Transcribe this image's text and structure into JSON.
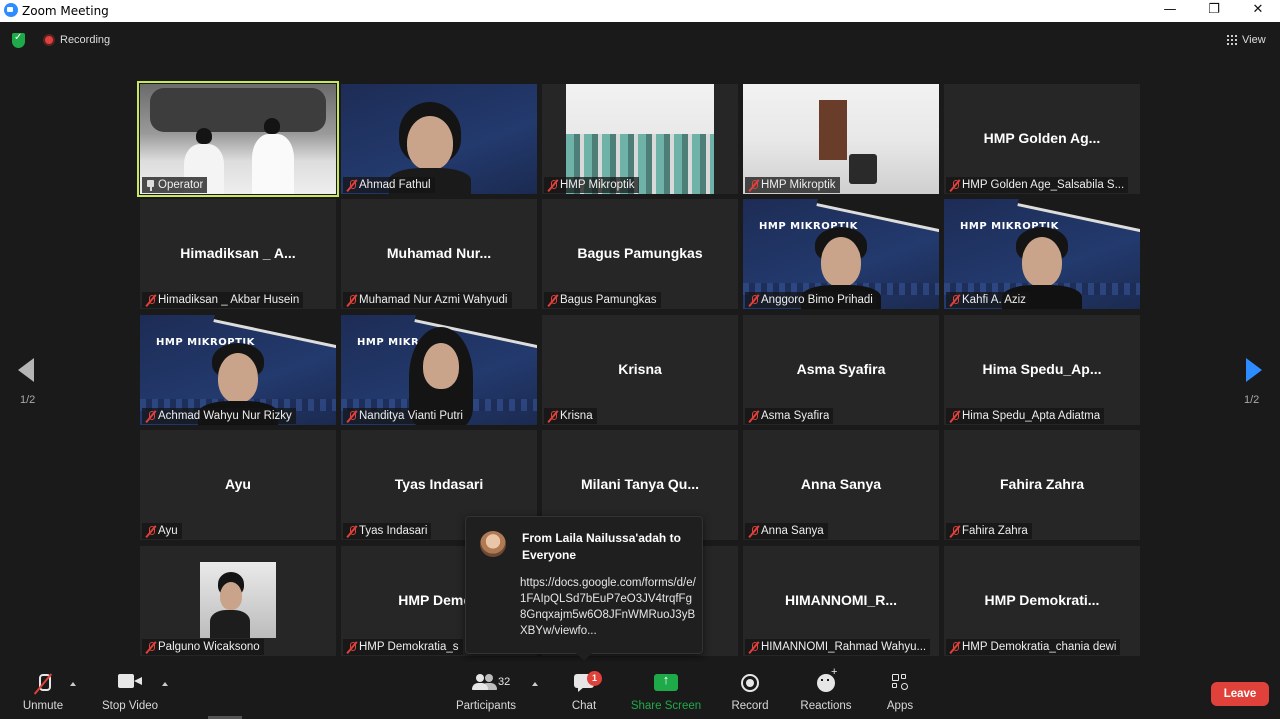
{
  "window": {
    "title": "Zoom Meeting",
    "minimize_glyph": "—",
    "restore_glyph": "❐",
    "close_glyph": "✕"
  },
  "topbar": {
    "recording_label": "Recording",
    "view_label": "View",
    "security_icon": "shield-check-icon"
  },
  "gallery": {
    "page_left": "1/2",
    "page_right": "1/2",
    "tiles": [
      {
        "display": "",
        "name": "Operator",
        "video": "operator",
        "pinned": true,
        "active": true
      },
      {
        "display": "",
        "name": "Ahmad Fathul",
        "video": "person-blue"
      },
      {
        "display": "",
        "name": "HMP Mikroptik",
        "video": "classroom"
      },
      {
        "display": "",
        "name": "HMP Mikroptik",
        "video": "room"
      },
      {
        "display": "HMP Golden Ag...",
        "name": "HMP Golden Age_Salsabila S..."
      },
      {
        "display": "Himadiksan _ A...",
        "name": "Himadiksan _ Akbar Husein"
      },
      {
        "display": "Muhamad Nur...",
        "name": "Muhamad Nur Azmi Wahyudi"
      },
      {
        "display": "Bagus Pamungkas",
        "name": "Bagus Pamungkas"
      },
      {
        "display": "",
        "name": "Anggoro Bimo Prihadi",
        "video": "banner-person"
      },
      {
        "display": "",
        "name": "Kahfi A. Aziz",
        "video": "banner-person"
      },
      {
        "display": "",
        "name": "Achmad Wahyu Nur Rizky",
        "video": "banner-person"
      },
      {
        "display": "",
        "name": "Nanditya Vianti Putri",
        "video": "banner-hijab"
      },
      {
        "display": "Krisna",
        "name": "Krisna"
      },
      {
        "display": "Asma Syafira",
        "name": "Asma Syafira"
      },
      {
        "display": "Hima Spedu_Ap...",
        "name": "Hima Spedu_Apta Adiatma"
      },
      {
        "display": "Ayu",
        "name": "Ayu"
      },
      {
        "display": "Tyas Indasari",
        "name": "Tyas Indasari"
      },
      {
        "display": "Milani Tanya Qu...",
        "name": ""
      },
      {
        "display": "Anna Sanya",
        "name": "Anna Sanya"
      },
      {
        "display": "Fahira Zahra",
        "name": "Fahira Zahra"
      },
      {
        "display": "",
        "name": "Palguno Wicaksono",
        "video": "photo"
      },
      {
        "display": "HMP Demok",
        "name": "HMP Demokratia_s"
      },
      {
        "display": "",
        "name": ""
      },
      {
        "display": "HIMANNOMI_R...",
        "name": "HIMANNOMI_Rahmad Wahyu..."
      },
      {
        "display": "HMP Demokrati...",
        "name": "HMP Demokratia_chania dewi"
      }
    ],
    "banner_text": "HMP MIKROPTIK"
  },
  "chat_popup": {
    "from": "From Laila Nailussa'adah to Everyone",
    "message": "https://docs.google.com/forms/d/e/1FAIpQLSd7bEuP7eO3JV4trqfFg8Gnqxajm5w6O8JFnWMRuoJ3yBXBYw/viewfo..."
  },
  "toolbar": {
    "unmute": "Unmute",
    "stop_video": "Stop Video",
    "participants": "Participants",
    "participants_count": "32",
    "chat": "Chat",
    "chat_badge": "1",
    "share_screen": "Share Screen",
    "record": "Record",
    "reactions": "Reactions",
    "apps": "Apps",
    "leave": "Leave"
  },
  "colors": {
    "active_speaker": "#c7e85a",
    "share_green": "#1faa49",
    "leave_red": "#e0413a",
    "accent_blue": "#2d8cff"
  }
}
